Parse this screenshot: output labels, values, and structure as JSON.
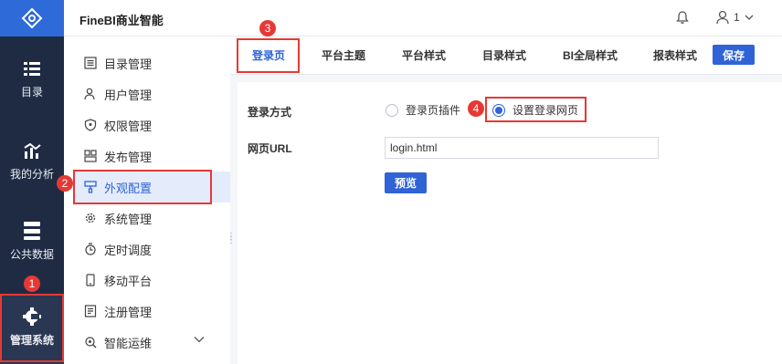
{
  "app": {
    "title": "FineBI商业智能"
  },
  "header": {
    "user_label": "1",
    "accent": "#2f63d6"
  },
  "rail": {
    "items": [
      {
        "label": "目录",
        "icon": "catalog-icon"
      },
      {
        "label": "我的分析",
        "icon": "chart-icon"
      },
      {
        "label": "公共数据",
        "icon": "database-icon"
      },
      {
        "label": "管理系统",
        "icon": "settings-icon",
        "active": true
      }
    ]
  },
  "submenu": {
    "items": [
      {
        "label": "目录管理",
        "icon": "list-icon"
      },
      {
        "label": "用户管理",
        "icon": "user-icon"
      },
      {
        "label": "权限管理",
        "icon": "shield-icon"
      },
      {
        "label": "发布管理",
        "icon": "publish-icon"
      },
      {
        "label": "外观配置",
        "icon": "brush-icon",
        "active": true
      },
      {
        "label": "系统管理",
        "icon": "gear-icon"
      },
      {
        "label": "定时调度",
        "icon": "timer-icon"
      },
      {
        "label": "移动平台",
        "icon": "mobile-icon"
      },
      {
        "label": "注册管理",
        "icon": "register-icon"
      },
      {
        "label": "智能运维",
        "icon": "ops-icon"
      }
    ]
  },
  "tabs": [
    {
      "label": "登录页",
      "active": true
    },
    {
      "label": "平台主题"
    },
    {
      "label": "平台样式"
    },
    {
      "label": "目录样式"
    },
    {
      "label": "BI全局样式"
    },
    {
      "label": "报表样式"
    }
  ],
  "toolbar": {
    "save_label": "保存"
  },
  "form": {
    "login_method_label": "登录方式",
    "option_plugin": "登录页插件",
    "option_custom": "设置登录网页",
    "selected": "设置登录网页",
    "url_label": "网页URL",
    "url_value": "login.html",
    "preview_label": "预览"
  },
  "annotations": [
    "1",
    "2",
    "3",
    "4"
  ],
  "colors": {
    "annotation": "#e53935",
    "rail_bg": "#1f2b43",
    "logo_bg": "#2e6ad8"
  }
}
